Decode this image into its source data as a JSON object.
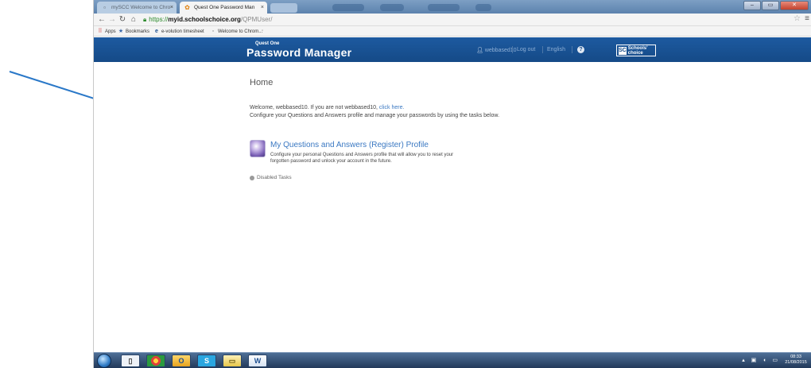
{
  "browser": {
    "tabs": [
      {
        "label": "mySCC Welcome to Chro",
        "active": false
      },
      {
        "label": "Quest One Password Man",
        "active": true
      }
    ],
    "url": {
      "scheme": "https://",
      "host": "myid.schoolschoice.org",
      "path": "/QPMUser/"
    },
    "bookmarks": [
      {
        "label": "Apps",
        "icon": "apps-grid-icon"
      },
      {
        "label": "Bookmarks",
        "icon": "star-icon"
      },
      {
        "label": "e-volution timesheet",
        "icon": "e-icon"
      },
      {
        "label": "Welcome to Chrom...",
        "icon": "page-icon"
      }
    ]
  },
  "header": {
    "brand_top": "Quest One",
    "brand": "Password Manager",
    "user": "webbased10",
    "logout": "Log out",
    "language": "English",
    "help_icon": "?",
    "logo_text": "Schools' choice",
    "logo_mark": "SC"
  },
  "main": {
    "title": "Home",
    "welcome_prefix": "Welcome, webbased10. If you are not webbased10, ",
    "welcome_link": "click here.",
    "instructions": "Configure your Questions and Answers profile and manage your passwords by using the tasks below.",
    "task": {
      "title": "My Questions and Answers (Register) Profile",
      "desc_line1": "Configure your personal Questions and Answers profile that will allow you to reset your",
      "desc_line2": "forgotten password and unlock your account in the future."
    },
    "disabled_tasks": "Disabled Tasks"
  },
  "taskbar": {
    "apps": [
      "explorer-icon",
      "chrome-icon",
      "outlook-icon",
      "skype-icon",
      "folder-icon",
      "word-icon"
    ],
    "clock_time": "08:33",
    "clock_date": "21/08/2015"
  },
  "colors": {
    "header_blue": "#1d5aa0",
    "link_blue": "#3a78c2",
    "annotation_arrow": "#2a78c8"
  }
}
